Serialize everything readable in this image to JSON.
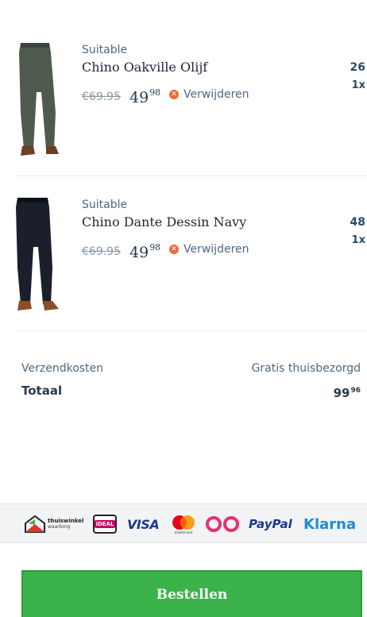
{
  "cart": {
    "items": [
      {
        "brand": "Suitable",
        "name": "Chino Oakville Olijf",
        "old_price": "€69.95",
        "price_main": "49",
        "price_cents": "98",
        "remove_label": "Verwijderen",
        "qty_value": "26",
        "qty_count": "1x",
        "pants_color": "#4f5a4f"
      },
      {
        "brand": "Suitable",
        "name": "Chino Dante Dessin Navy",
        "old_price": "€69.95",
        "price_main": "49",
        "price_cents": "98",
        "remove_label": "Verwijderen",
        "qty_value": "48",
        "qty_count": "1x",
        "pants_color": "#1b1f2b"
      }
    ]
  },
  "summary": {
    "shipping_label": "Verzendkosten",
    "shipping_value": "Gratis thuisbezorgd",
    "total_label": "Totaal",
    "total_main": "99",
    "total_cents": "96"
  },
  "payment_logos": {
    "thuiswinkel_line1": "thuiswinkel",
    "thuiswinkel_line2": "waarborg",
    "ideal": "iDEAL",
    "visa": "VISA",
    "mastercard": "mastercard",
    "paypal": "PayPal",
    "klarna": "Klarna"
  },
  "checkout": {
    "button_label": "Bestellen"
  },
  "colors": {
    "accent_green": "#3cb34a",
    "remove_icon": "#ea6b3a",
    "text_primary": "#2a3a4d",
    "text_muted": "#4d6785"
  }
}
